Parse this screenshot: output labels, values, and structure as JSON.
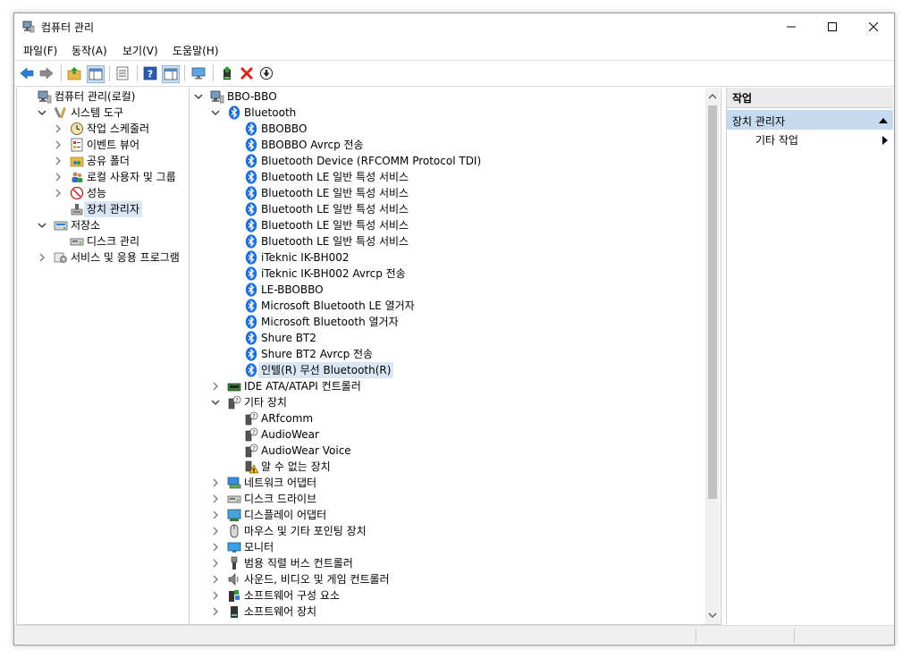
{
  "window": {
    "title": "컴퓨터 관리"
  },
  "menu": [
    "파일(F)",
    "동작(A)",
    "보기(V)",
    "도움말(H)"
  ],
  "left_tree": [
    {
      "label": "컴퓨터 관리(로컬)",
      "level": 0,
      "icon": "computer-management-icon",
      "expander": "none"
    },
    {
      "label": "시스템 도구",
      "level": 1,
      "icon": "system-tools-icon",
      "expander": "expanded"
    },
    {
      "label": "작업 스케줄러",
      "level": 2,
      "icon": "clock-icon",
      "expander": "collapsed"
    },
    {
      "label": "이벤트 뷰어",
      "level": 2,
      "icon": "event-viewer-icon",
      "expander": "collapsed"
    },
    {
      "label": "공유 폴더",
      "level": 2,
      "icon": "shared-folder-icon",
      "expander": "collapsed"
    },
    {
      "label": "로컬 사용자 및 그룹",
      "level": 2,
      "icon": "users-icon",
      "expander": "collapsed"
    },
    {
      "label": "성능",
      "level": 2,
      "icon": "performance-icon",
      "expander": "collapsed"
    },
    {
      "label": "장치 관리자",
      "level": 2,
      "icon": "device-manager-icon",
      "expander": "none",
      "selected": true
    },
    {
      "label": "저장소",
      "level": 1,
      "icon": "storage-icon",
      "expander": "expanded"
    },
    {
      "label": "디스크 관리",
      "level": 2,
      "icon": "disk-icon",
      "expander": "none"
    },
    {
      "label": "서비스 및 응용 프로그램",
      "level": 1,
      "icon": "services-icon",
      "expander": "collapsed"
    }
  ],
  "device_tree": [
    {
      "label": "BBO-BBO",
      "level": 0,
      "icon": "computer-icon",
      "expander": "expanded"
    },
    {
      "label": "Bluetooth",
      "level": 1,
      "icon": "bluetooth-icon",
      "expander": "expanded"
    },
    {
      "label": "BBOBBO",
      "level": 2,
      "icon": "bluetooth-icon",
      "expander": "none"
    },
    {
      "label": "BBOBBO Avrcp 전송",
      "level": 2,
      "icon": "bluetooth-icon",
      "expander": "none"
    },
    {
      "label": "Bluetooth Device (RFCOMM Protocol TDI)",
      "level": 2,
      "icon": "bluetooth-icon",
      "expander": "none"
    },
    {
      "label": "Bluetooth LE 일반 특성 서비스",
      "level": 2,
      "icon": "bluetooth-icon",
      "expander": "none"
    },
    {
      "label": "Bluetooth LE 일반 특성 서비스",
      "level": 2,
      "icon": "bluetooth-icon",
      "expander": "none"
    },
    {
      "label": "Bluetooth LE 일반 특성 서비스",
      "level": 2,
      "icon": "bluetooth-icon",
      "expander": "none"
    },
    {
      "label": "Bluetooth LE 일반 특성 서비스",
      "level": 2,
      "icon": "bluetooth-icon",
      "expander": "none"
    },
    {
      "label": "Bluetooth LE 일반 특성 서비스",
      "level": 2,
      "icon": "bluetooth-icon",
      "expander": "none"
    },
    {
      "label": "iTeknic IK-BH002",
      "level": 2,
      "icon": "bluetooth-icon",
      "expander": "none"
    },
    {
      "label": "iTeknic IK-BH002 Avrcp 전송",
      "level": 2,
      "icon": "bluetooth-icon",
      "expander": "none"
    },
    {
      "label": "LE-BBOBBO",
      "level": 2,
      "icon": "bluetooth-icon",
      "expander": "none"
    },
    {
      "label": "Microsoft Bluetooth LE 열거자",
      "level": 2,
      "icon": "bluetooth-icon",
      "expander": "none"
    },
    {
      "label": "Microsoft Bluetooth 열거자",
      "level": 2,
      "icon": "bluetooth-icon",
      "expander": "none"
    },
    {
      "label": "Shure BT2",
      "level": 2,
      "icon": "bluetooth-icon",
      "expander": "none"
    },
    {
      "label": "Shure BT2 Avrcp 전송",
      "level": 2,
      "icon": "bluetooth-icon",
      "expander": "none"
    },
    {
      "label": "인텔(R) 무선 Bluetooth(R)",
      "level": 2,
      "icon": "bluetooth-icon",
      "expander": "none",
      "selected": true
    },
    {
      "label": "IDE ATA/ATAPI 컨트롤러",
      "level": 1,
      "icon": "ide-controller-icon",
      "expander": "collapsed"
    },
    {
      "label": "기타 장치",
      "level": 1,
      "icon": "unknown-device-icon",
      "expander": "expanded"
    },
    {
      "label": "ARfcomm",
      "level": 2,
      "icon": "unknown-device-icon",
      "expander": "none"
    },
    {
      "label": "AudioWear",
      "level": 2,
      "icon": "unknown-device-icon",
      "expander": "none"
    },
    {
      "label": "AudioWear Voice",
      "level": 2,
      "icon": "unknown-device-icon",
      "expander": "none"
    },
    {
      "label": "알 수 없는 장치",
      "level": 2,
      "icon": "warning-device-icon",
      "expander": "none"
    },
    {
      "label": "네트워크 어댑터",
      "level": 1,
      "icon": "network-adapter-icon",
      "expander": "collapsed"
    },
    {
      "label": "디스크 드라이브",
      "level": 1,
      "icon": "disk-drive-icon",
      "expander": "collapsed"
    },
    {
      "label": "디스플레이 어댑터",
      "level": 1,
      "icon": "display-adapter-icon",
      "expander": "collapsed"
    },
    {
      "label": "마우스 및 기타 포인팅 장치",
      "level": 1,
      "icon": "mouse-icon",
      "expander": "collapsed"
    },
    {
      "label": "모니터",
      "level": 1,
      "icon": "monitor-icon",
      "expander": "collapsed"
    },
    {
      "label": "범용 직렬 버스 컨트롤러",
      "level": 1,
      "icon": "usb-icon",
      "expander": "collapsed"
    },
    {
      "label": "사운드, 비디오 및 게임 컨트롤러",
      "level": 1,
      "icon": "speaker-icon",
      "expander": "collapsed"
    },
    {
      "label": "소프트웨어 구성 요소",
      "level": 1,
      "icon": "software-component-icon",
      "expander": "collapsed"
    },
    {
      "label": "소프트웨어 장치",
      "level": 1,
      "icon": "software-device-icon",
      "expander": "collapsed"
    }
  ],
  "actions": {
    "header": "작업",
    "section": "장치 관리자",
    "items": [
      "기타 작업"
    ]
  },
  "colors": {
    "bluetooth": "#1e70d6",
    "selection": "#d9e7f5",
    "action_section": "#c5d9ef"
  }
}
